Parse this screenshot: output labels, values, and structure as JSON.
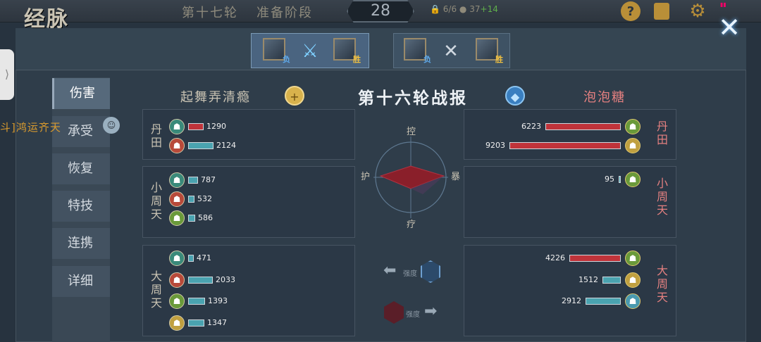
{
  "header": {
    "logo": "经脉",
    "round": "第十七轮",
    "phase": "准备阶段",
    "timer": "28",
    "resource_a": "6/6",
    "resource_b": "37",
    "resource_b_bonus": "+14",
    "help_icon": "question-icon",
    "book_icon": "book-icon",
    "settings_icon": "gear-icon"
  },
  "matches": [
    {
      "left_badge": "负",
      "right_badge": "胜"
    },
    {
      "left_badge": "负",
      "right_badge": "胜"
    }
  ],
  "nav": {
    "items": [
      "伤害",
      "承受",
      "恢复",
      "特技",
      "连携",
      "详细"
    ],
    "active": 0
  },
  "floater_text": "斗]鸿运齐天",
  "report": {
    "left_team": "起舞弄清瘾",
    "title": "第十六轮战报",
    "right_team": "泡泡糖",
    "radar_axes": {
      "top": "控",
      "right": "暴",
      "bottom": "疗",
      "left": "护"
    },
    "strength_label": "强度"
  },
  "left": {
    "dantian": {
      "label": "丹田",
      "units": [
        {
          "value": "1290",
          "color": "red"
        },
        {
          "value": "2124",
          "color": "teal"
        }
      ]
    },
    "xiaozhoutian": {
      "label": "小周天",
      "units": [
        {
          "value": "787",
          "color": "teal"
        },
        {
          "value": "532",
          "color": "teal"
        },
        {
          "value": "586",
          "color": "teal"
        }
      ]
    },
    "dazhoutian": {
      "label": "大周天",
      "units": [
        {
          "value": "471",
          "color": "teal"
        },
        {
          "value": "2033",
          "color": "teal"
        },
        {
          "value": "1393",
          "color": "teal"
        },
        {
          "value": "1347",
          "color": "teal"
        }
      ]
    }
  },
  "right": {
    "dantian": {
      "label": "丹田",
      "units": [
        {
          "value": "6223",
          "color": "red"
        },
        {
          "value": "9203",
          "color": "red"
        }
      ]
    },
    "xiaozhoutian": {
      "label": "小周天",
      "units": [
        {
          "value": "95",
          "color": "teal"
        }
      ]
    },
    "dazhoutian": {
      "label": "大周天",
      "units": [
        {
          "value": "4226",
          "color": "red"
        },
        {
          "value": "1512",
          "color": "teal"
        },
        {
          "value": "2912",
          "color": "teal"
        }
      ]
    }
  },
  "colors": {
    "accent": "#b98f38",
    "red_bar": "#c0333a",
    "teal_bar": "#4aa3b0",
    "left_team": "#c9c3b3",
    "right_team": "#e48080"
  }
}
